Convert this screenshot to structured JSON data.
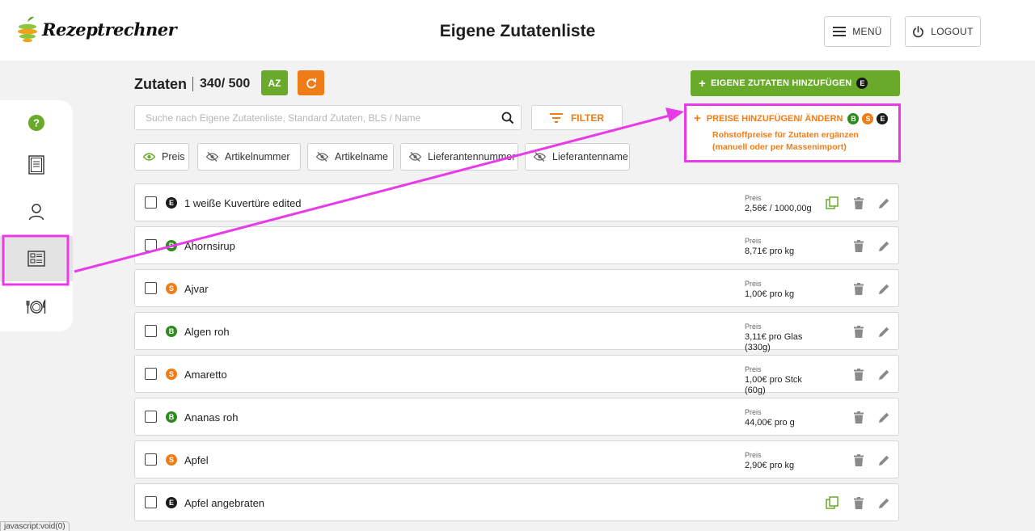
{
  "header": {
    "logo_text": "Rezeptrechner",
    "title": "Eigene Zutatenliste",
    "menu_label": "MENÜ",
    "logout_label": "LOGOUT"
  },
  "toolbar": {
    "title": "Zutaten",
    "count": "340/ 500",
    "sort_label": "AZ",
    "add_button_label": "EIGENE ZUTATEN HINZUFÜGEN",
    "add_button_badge": "E",
    "search_placeholder": "Suche nach Eigene Zutatenliste, Standard Zutaten, BLS / Name",
    "filter_label": "FILTER"
  },
  "price_panel": {
    "title": "PREISE HINZUFÜGEN/ ÄNDERN",
    "badges": [
      "B",
      "S",
      "E"
    ],
    "desc_line1": "Rohstoffpreise für Zutaten ergänzen",
    "desc_line2": "(manuell oder per Massenimport)"
  },
  "chips": [
    {
      "label": "Preis",
      "visible": true
    },
    {
      "label": "Artikelnummer",
      "visible": false
    },
    {
      "label": "Artikelname",
      "visible": false
    },
    {
      "label": "Lieferantennummer",
      "visible": false
    },
    {
      "label": "Lieferantenname",
      "visible": false
    }
  ],
  "list": {
    "price_label": "Preis",
    "rows": [
      {
        "badge": "E",
        "name": "1 weiße Kuvertüre edited",
        "price_line1": "2,56€ / 1000,00g",
        "price_line2": "",
        "copy": true
      },
      {
        "badge": "B",
        "name": "Ahornsirup",
        "price_line1": "8,71€ pro kg",
        "price_line2": "",
        "copy": false
      },
      {
        "badge": "S",
        "name": "Ajvar",
        "price_line1": "1,00€ pro kg",
        "price_line2": "",
        "copy": false
      },
      {
        "badge": "B",
        "name": "Algen roh",
        "price_line1": "3,11€ pro Glas",
        "price_line2": "(330g)",
        "copy": false
      },
      {
        "badge": "S",
        "name": "Amaretto",
        "price_line1": "1,00€ pro Stck",
        "price_line2": "(60g)",
        "copy": false
      },
      {
        "badge": "B",
        "name": "Ananas roh",
        "price_line1": "44,00€ pro g",
        "price_line2": "",
        "copy": false
      },
      {
        "badge": "S",
        "name": "Apfel",
        "price_line1": "2,90€ pro kg",
        "price_line2": "",
        "copy": false
      },
      {
        "badge": "E",
        "name": "Apfel angebraten",
        "price_line1": "",
        "price_line2": "",
        "copy": true
      }
    ]
  },
  "status_bar": {
    "link": "javascript:void(0)"
  },
  "colors": {
    "green": "#6aaa2a",
    "orange": "#f07c18",
    "highlight": "#e83be8",
    "badge_e": "#1a1a1a",
    "badge_b": "#2f8a1f"
  }
}
